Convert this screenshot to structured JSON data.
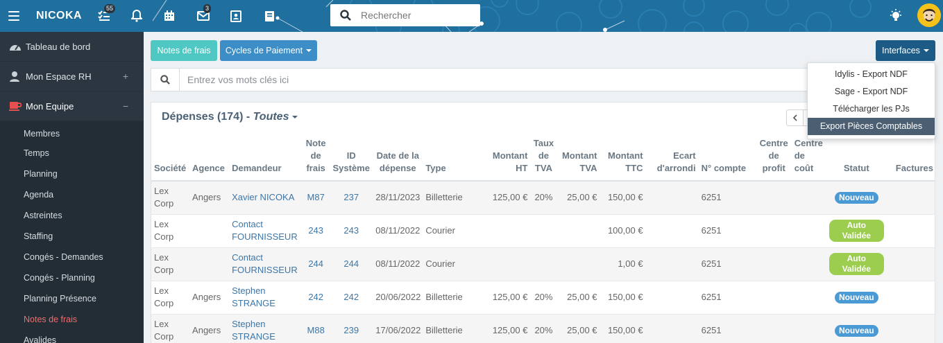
{
  "app": {
    "name": "NICOKA",
    "search_placeholder": "Rechercher",
    "tasks_badge": "55",
    "mail_badge": "3"
  },
  "sidebar": {
    "sections": [
      {
        "label": "Tableau de bord",
        "icon": "dashboard-icon"
      },
      {
        "label": "Mon Espace RH",
        "icon": "user-icon",
        "toggle": "+"
      },
      {
        "label": "Mon Equipe",
        "icon": "coffee-icon",
        "toggle": "−"
      }
    ],
    "items": [
      {
        "label": "Membres"
      },
      {
        "label": "Temps"
      },
      {
        "label": "Planning"
      },
      {
        "label": "Agenda"
      },
      {
        "label": "Astreintes"
      },
      {
        "label": "Staffing"
      },
      {
        "label": "Congés - Demandes"
      },
      {
        "label": "Congés - Planning"
      },
      {
        "label": "Planning Présence"
      },
      {
        "label": "Notes de frais"
      },
      {
        "label": "Avalides"
      }
    ]
  },
  "toolbar": {
    "notes_label": "Notes de frais",
    "cycles_label": "Cycles de Paiement",
    "interfaces_label": "Interfaces"
  },
  "interfaces_menu": [
    {
      "label": "Idylis - Export NDF"
    },
    {
      "label": "Sage - Export NDF"
    },
    {
      "label": "Télécharger les PJs"
    },
    {
      "label": "Export Pièces Comptables"
    }
  ],
  "search": {
    "placeholder": "Entrez vos mots clés ici"
  },
  "panel": {
    "title": "Dépenses (174) - ",
    "filter": "Toutes"
  },
  "table": {
    "headers": [
      "Société",
      "Agence",
      "Demandeur",
      "Note de frais",
      "ID Système",
      "Date de la dépense",
      "Type",
      "Montant HT",
      "Taux de TVA",
      "Montant TVA",
      "Montant TTC",
      "Ecart d'arrondi",
      "N° compte",
      "Centre de profit",
      "Centre de coût",
      "Statut",
      "Factures"
    ],
    "rows": [
      {
        "societe": "Lex Corp",
        "agence": "Angers",
        "demandeur": "Xavier NICOKA",
        "note": "M87",
        "id": "237",
        "date": "28/11/2023",
        "type": "Billetterie",
        "ht": "125,00 €",
        "taux": "20%",
        "tva": "25,00 €",
        "ttc": "150,00 €",
        "compte": "6251",
        "statut": "Nouveau",
        "statut_color": "#4a9ad6"
      },
      {
        "societe": "Lex Corp",
        "agence": "",
        "demandeur": "Contact FOURNISSEUR",
        "note": "243",
        "id": "243",
        "date": "08/11/2022",
        "type": "Courier",
        "ht": "",
        "taux": "",
        "tva": "",
        "ttc": "100,00 €",
        "compte": "6251",
        "statut": "Auto Validée",
        "statut_color": "#9ccd4f"
      },
      {
        "societe": "Lex Corp",
        "agence": "",
        "demandeur": "Contact FOURNISSEUR",
        "note": "244",
        "id": "244",
        "date": "08/11/2022",
        "type": "Courier",
        "ht": "",
        "taux": "",
        "tva": "",
        "ttc": "1,00 €",
        "compte": "6251",
        "statut": "Auto Validée",
        "statut_color": "#9ccd4f"
      },
      {
        "societe": "Lex Corp",
        "agence": "Angers",
        "demandeur": "Stephen STRANGE",
        "note": "242",
        "id": "242",
        "date": "20/06/2022",
        "type": "Billetterie",
        "ht": "125,00 €",
        "taux": "20%",
        "tva": "25,00 €",
        "ttc": "150,00 €",
        "compte": "6251",
        "statut": "Nouveau",
        "statut_color": "#4a9ad6"
      },
      {
        "societe": "Lex Corp",
        "agence": "Angers",
        "demandeur": "Stephen STRANGE",
        "note": "M88",
        "id": "239",
        "date": "17/06/2022",
        "type": "Billetterie",
        "ht": "125,00 €",
        "taux": "20%",
        "tva": "25,00 €",
        "ttc": "150,00 €",
        "compte": "6251",
        "statut": "Nouveau",
        "statut_color": "#4a9ad6"
      }
    ]
  }
}
